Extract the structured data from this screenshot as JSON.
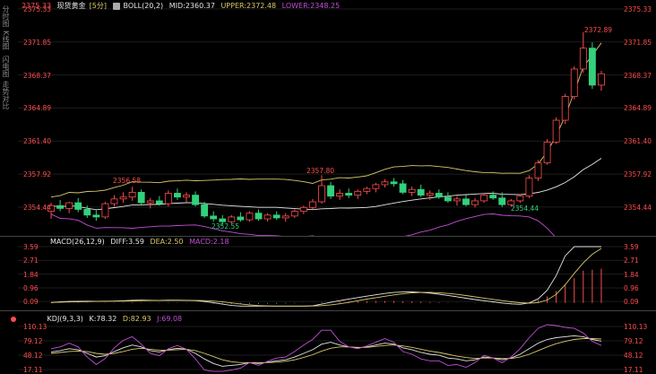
{
  "colors": {
    "up": "#ff4d4d",
    "down": "#32d17b",
    "upper": "#d7c96a",
    "mid": "#e6e6e6",
    "lower": "#c24fd6",
    "diff": "#e6e6e6",
    "dea": "#d7c96a",
    "macd_up": "#ff4d4d",
    "macd_down": "#32d17b",
    "k": "#e6e6e6",
    "d": "#d7c96a",
    "j": "#c24fd6",
    "axis_text": "#ff4d4d",
    "header_text": "#cccccc"
  },
  "sidebar": {
    "labels": [
      "分时图",
      "K线图",
      "闪电图",
      "走势对比"
    ]
  },
  "main": {
    "symbol": "现货黄金",
    "period": "[5分]",
    "boll_label": "BOLL(20,2)",
    "mid_label": "MID:2360.37",
    "upper_label": "UPPER:2372.48",
    "lower_label": "LOWER:2348.25",
    "left_top_value": "2375.33",
    "y_ticks": [
      "2375.33",
      "2371.85",
      "2368.37",
      "2364.89",
      "2361.40",
      "2357.92",
      "2354.44"
    ],
    "annotations": {
      "high1": "2356.58",
      "low1": "2352.55",
      "high2": "2357.80",
      "low2": "2354.44",
      "high3": "2372.89"
    }
  },
  "macd": {
    "label": "MACD(26,12,9)",
    "diff_label": "DIFF:3.59",
    "dea_label": "DEA:2.50",
    "macd_label": "MACD:2.18",
    "y_ticks": [
      "3.59",
      "2.71",
      "1.84",
      "0.96",
      "0.09"
    ]
  },
  "kdj": {
    "label": "KDJ(9,3,3)",
    "k_label": "K:78.32",
    "d_label": "D:82.93",
    "j_label": "J:69.08",
    "y_ticks": [
      "110.13",
      "79.12",
      "48.12",
      "17.11"
    ]
  },
  "chart_data": [
    {
      "type": "candlestick",
      "title": "现货黄金 [5分]",
      "ylim": [
        2351.5,
        2375.33
      ],
      "candles": [
        [
          2354.0,
          2354.9,
          2353.2,
          2354.6
        ],
        [
          2354.6,
          2355.2,
          2354.0,
          2354.3
        ],
        [
          2354.3,
          2355.0,
          2353.8,
          2354.9
        ],
        [
          2354.9,
          2355.4,
          2353.9,
          2354.2
        ],
        [
          2354.2,
          2354.6,
          2353.3,
          2353.6
        ],
        [
          2353.6,
          2354.1,
          2353.0,
          2353.4
        ],
        [
          2353.4,
          2355.0,
          2353.2,
          2354.8
        ],
        [
          2354.8,
          2355.7,
          2354.5,
          2355.3
        ],
        [
          2355.3,
          2356.0,
          2354.9,
          2355.5
        ],
        [
          2355.5,
          2356.58,
          2355.1,
          2356.0
        ],
        [
          2356.0,
          2356.3,
          2354.6,
          2354.9
        ],
        [
          2354.9,
          2355.4,
          2354.3,
          2355.1
        ],
        [
          2355.1,
          2355.6,
          2354.6,
          2354.8
        ],
        [
          2354.8,
          2356.2,
          2354.5,
          2355.9
        ],
        [
          2355.9,
          2356.4,
          2355.2,
          2355.5
        ],
        [
          2355.5,
          2356.0,
          2354.9,
          2355.7
        ],
        [
          2355.7,
          2356.1,
          2354.5,
          2354.7
        ],
        [
          2354.7,
          2355.0,
          2353.3,
          2353.5
        ],
        [
          2353.5,
          2354.0,
          2352.9,
          2353.2
        ],
        [
          2353.2,
          2353.6,
          2352.55,
          2352.9
        ],
        [
          2352.9,
          2353.6,
          2352.7,
          2353.4
        ],
        [
          2353.4,
          2353.9,
          2352.9,
          2353.1
        ],
        [
          2353.1,
          2354.0,
          2352.9,
          2353.8
        ],
        [
          2353.8,
          2354.2,
          2353.0,
          2353.2
        ],
        [
          2353.2,
          2353.8,
          2352.9,
          2353.6
        ],
        [
          2353.6,
          2354.0,
          2353.1,
          2353.3
        ],
        [
          2353.3,
          2353.8,
          2352.9,
          2353.5
        ],
        [
          2353.5,
          2354.2,
          2353.3,
          2354.0
        ],
        [
          2354.0,
          2354.6,
          2353.7,
          2354.4
        ],
        [
          2354.4,
          2355.3,
          2354.2,
          2355.0
        ],
        [
          2355.0,
          2357.8,
          2354.8,
          2356.7
        ],
        [
          2356.7,
          2357.1,
          2355.3,
          2355.6
        ],
        [
          2355.6,
          2356.3,
          2355.2,
          2355.9
        ],
        [
          2355.9,
          2356.4,
          2355.4,
          2355.7
        ],
        [
          2355.7,
          2356.3,
          2355.3,
          2356.1
        ],
        [
          2356.1,
          2356.6,
          2355.8,
          2356.4
        ],
        [
          2356.4,
          2357.0,
          2356.0,
          2356.8
        ],
        [
          2356.8,
          2357.4,
          2356.5,
          2357.1
        ],
        [
          2357.1,
          2357.5,
          2356.6,
          2356.9
        ],
        [
          2356.9,
          2357.3,
          2355.8,
          2356.0
        ],
        [
          2356.0,
          2356.6,
          2355.6,
          2356.3
        ],
        [
          2356.3,
          2356.8,
          2355.5,
          2355.7
        ],
        [
          2355.7,
          2356.2,
          2355.2,
          2355.9
        ],
        [
          2355.9,
          2356.3,
          2355.3,
          2355.5
        ],
        [
          2355.5,
          2356.0,
          2354.9,
          2355.1
        ],
        [
          2355.1,
          2355.6,
          2354.6,
          2355.3
        ],
        [
          2355.3,
          2355.7,
          2354.5,
          2354.7
        ],
        [
          2354.7,
          2355.4,
          2354.4,
          2355.1
        ],
        [
          2355.1,
          2355.9,
          2354.9,
          2355.7
        ],
        [
          2355.7,
          2356.1,
          2355.2,
          2355.4
        ],
        [
          2355.4,
          2356.0,
          2354.44,
          2354.7
        ],
        [
          2354.7,
          2355.3,
          2354.5,
          2355.1
        ],
        [
          2355.1,
          2355.8,
          2354.9,
          2355.6
        ],
        [
          2355.6,
          2357.8,
          2355.4,
          2357.5
        ],
        [
          2357.5,
          2359.4,
          2357.2,
          2359.1
        ],
        [
          2359.1,
          2361.6,
          2358.9,
          2361.3
        ],
        [
          2361.3,
          2363.9,
          2361.1,
          2363.6
        ],
        [
          2363.6,
          2366.4,
          2363.2,
          2366.1
        ],
        [
          2366.1,
          2369.3,
          2365.8,
          2369.0
        ],
        [
          2369.0,
          2372.89,
          2368.6,
          2371.2
        ],
        [
          2371.2,
          2371.8,
          2366.9,
          2367.3
        ],
        [
          2367.3,
          2368.8,
          2366.7,
          2368.5
        ]
      ]
    },
    {
      "type": "bar",
      "title": "MACD(26,12,9)",
      "ylim": [
        -0.3,
        3.59
      ],
      "values": [
        0.02,
        0.03,
        0.03,
        0.02,
        0.02,
        0.01,
        0.02,
        0.02,
        0.03,
        0.04,
        0.03,
        0.02,
        0.02,
        0.03,
        0.02,
        0.02,
        0.01,
        -0.02,
        -0.04,
        -0.06,
        -0.07,
        -0.07,
        -0.06,
        -0.06,
        -0.05,
        -0.05,
        -0.04,
        -0.03,
        -0.01,
        0.01,
        0.05,
        0.07,
        0.08,
        0.09,
        0.1,
        0.11,
        0.12,
        0.13,
        0.13,
        0.11,
        0.1,
        0.08,
        0.06,
        0.04,
        0.02,
        0.01,
        -0.01,
        -0.02,
        -0.02,
        -0.03,
        -0.04,
        -0.04,
        -0.03,
        0.05,
        0.18,
        0.42,
        0.76,
        1.12,
        1.58,
        2.06,
        2.12,
        2.18
      ]
    },
    {
      "type": "line",
      "title": "KDJ(9,3,3)",
      "ylim": [
        17.11,
        110.13
      ],
      "series": [
        {
          "name": "K",
          "values": [
            55,
            58,
            62,
            60,
            52,
            44,
            47,
            56,
            64,
            70,
            66,
            58,
            55,
            60,
            63,
            61,
            52,
            40,
            30,
            24,
            26,
            28,
            32,
            30,
            33,
            36,
            38,
            44,
            52,
            60,
            72,
            76,
            70,
            66,
            64,
            66,
            70,
            74,
            72,
            64,
            60,
            54,
            50,
            48,
            42,
            40,
            36,
            38,
            44,
            42,
            38,
            42,
            50,
            62,
            74,
            82,
            86,
            88,
            90,
            88,
            82,
            78.32
          ]
        },
        {
          "name": "D",
          "values": [
            52,
            54,
            56,
            57,
            56,
            52,
            50,
            52,
            56,
            61,
            63,
            61,
            59,
            59,
            60,
            61,
            58,
            52,
            45,
            38,
            34,
            32,
            32,
            32,
            32,
            33,
            35,
            38,
            43,
            49,
            57,
            63,
            66,
            66,
            65,
            65,
            67,
            69,
            70,
            68,
            65,
            61,
            57,
            54,
            50,
            46,
            43,
            41,
            42,
            42,
            41,
            41,
            44,
            50,
            58,
            66,
            73,
            78,
            82,
            84,
            84,
            82.93
          ]
        },
        {
          "name": "J",
          "values": [
            62,
            66,
            74,
            66,
            44,
            28,
            41,
            64,
            80,
            88,
            72,
            52,
            47,
            62,
            69,
            61,
            40,
            16,
            10,
            10,
            16,
            20,
            32,
            26,
            35,
            42,
            44,
            56,
            70,
            82,
            102,
            102,
            78,
            66,
            62,
            68,
            76,
            84,
            76,
            56,
            50,
            40,
            36,
            36,
            26,
            28,
            22,
            32,
            48,
            42,
            32,
            44,
            62,
            86,
            106,
            114,
            112,
            108,
            106,
            96,
            78,
            69.08
          ]
        }
      ]
    }
  ]
}
